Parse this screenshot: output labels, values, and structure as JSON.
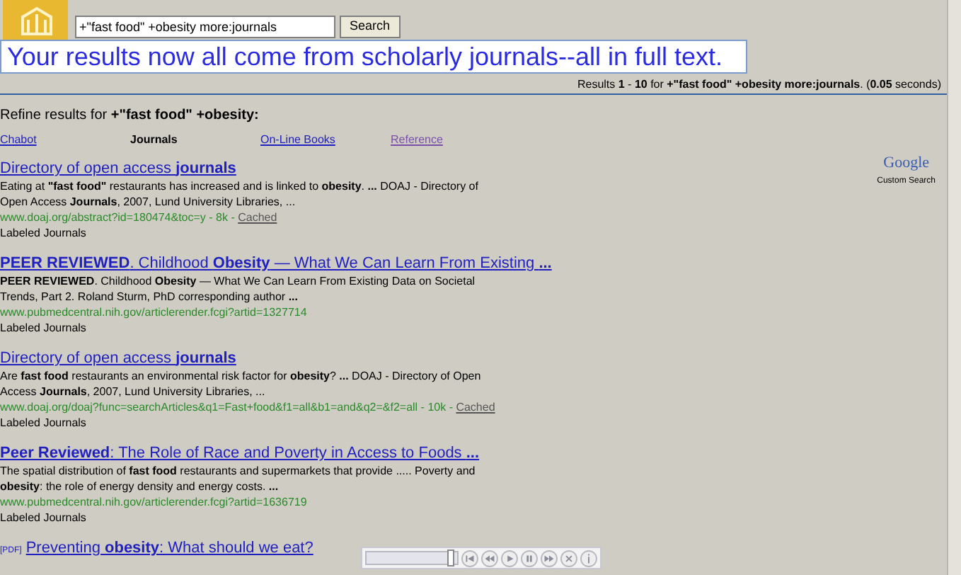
{
  "search": {
    "value": "+\"fast food\" +obesity more:journals",
    "button": "Search"
  },
  "banner": "Your results now all come from scholarly journals--all in full text.",
  "results_summary": "Results **1** - **10** for **+\"fast food\" +obesity more:journals**. (**0.05** seconds)",
  "refine": {
    "label": "Refine results for **+\"fast food\" +obesity:**",
    "tabs": [
      {
        "label": "Chabot",
        "selected": false,
        "visited": false
      },
      {
        "label": "Journals",
        "selected": true
      },
      {
        "label": "On-Line Books",
        "selected": false,
        "visited": false
      },
      {
        "label": "Reference",
        "selected": false,
        "visited": true
      }
    ]
  },
  "branding": {
    "logo": "Google",
    "caption": "Custom Search"
  },
  "results": [
    {
      "title": "Directory of open access **journals**",
      "snippet": "Eating at **\"fast food\"** restaurants has increased and is linked to **obesity**. **...** DOAJ - Directory of Open Access **Journals**, 2007, Lund University Libraries, ...",
      "url": "www.doaj.org/abstract?id=180474&toc=y - 8k - ",
      "cached": "Cached",
      "label": "Labeled Journals"
    },
    {
      "title": "**PEER REVIEWED**. Childhood **Obesity** — What We Can Learn From Existing **...**",
      "snippet": "**PEER REVIEWED**. Childhood **Obesity** — What We Can Learn From Existing Data on Societal Trends, Part 2. Roland Sturm, PhD corresponding author **...**",
      "url": "www.pubmedcentral.nih.gov/articlerender.fcgi?artid=1327714",
      "label": "Labeled Journals"
    },
    {
      "title": "Directory of open access **journals**",
      "snippet": "Are **fast food** restaurants an environmental risk factor for **obesity**? **...** DOAJ - Directory of Open Access **Journals**, 2007, Lund University Libraries, ...",
      "url": "www.doaj.org/doaj?func=searchArticles&q1=Fast+food&f1=all&b1=and&q2=&f2=all - 10k - ",
      "cached": "Cached",
      "label": "Labeled Journals"
    },
    {
      "title": "**Peer Reviewed**: The Role of Race and Poverty in Access to Foods **...**",
      "snippet": "The spatial distribution of **fast food** restaurants and supermarkets that provide ..... Poverty and **obesity**: the role of energy density and energy costs. **...**",
      "url": "www.pubmedcentral.nih.gov/articlerender.fcgi?artid=1636719",
      "label": "Labeled Journals"
    },
    {
      "tag": "[PDF]",
      "title": "Preventing **obesity**: What should we eat?"
    }
  ],
  "player": {
    "level": 0.93
  }
}
